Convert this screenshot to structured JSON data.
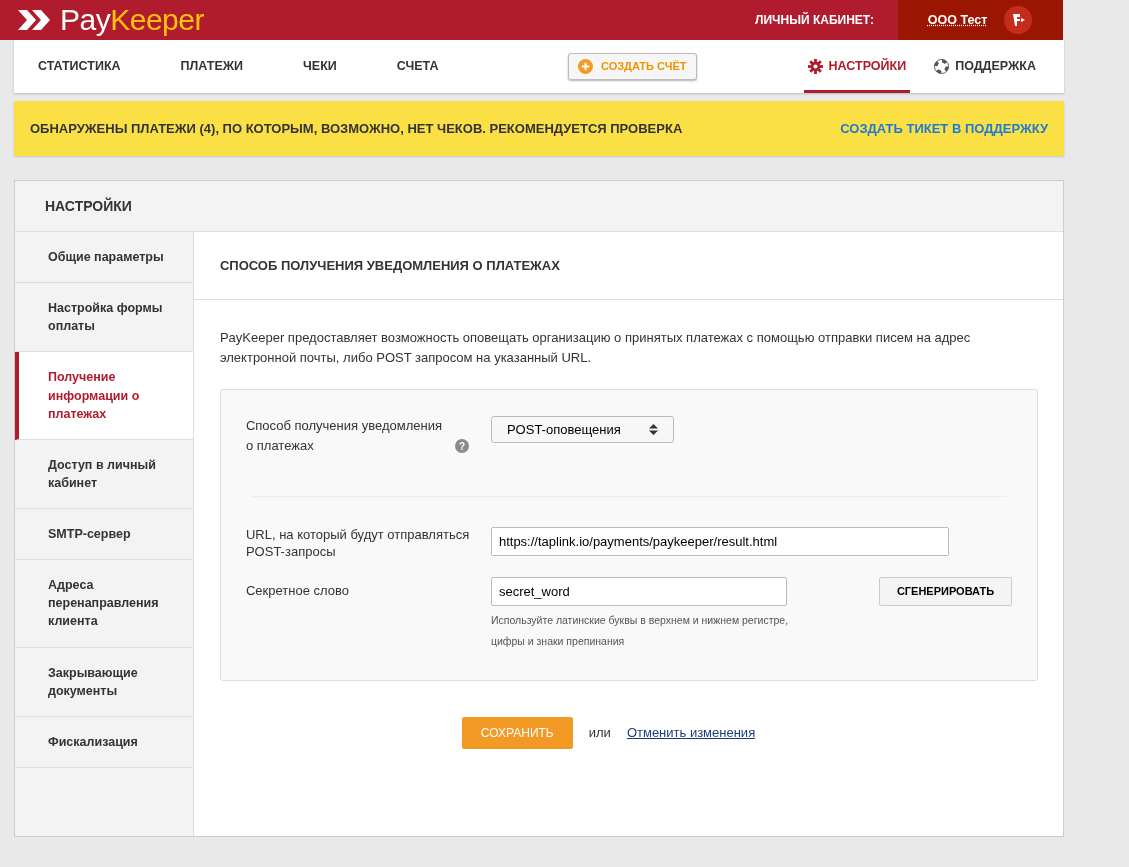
{
  "header": {
    "logo": {
      "first": "Pay",
      "second": "Keeper"
    },
    "cabinet_label": "ЛИЧНЫЙ КАБИНЕТ:",
    "account": "ООО Тест"
  },
  "nav": {
    "left": [
      {
        "label": "СТАТИСТИКА",
        "selected": false
      },
      {
        "label": "ПЛАТЕЖИ",
        "selected": false
      },
      {
        "label": "ЧЕКИ",
        "selected": false
      },
      {
        "label": "СЧЕТА",
        "selected": false
      }
    ],
    "create_button": "СОЗДАТЬ СЧЁТ",
    "right": [
      {
        "label": "НАСТРОЙКИ",
        "kind": "gear",
        "selected": true
      },
      {
        "label": "ПОДДЕРЖКА",
        "kind": "lifebuoy",
        "selected": false
      }
    ]
  },
  "alert": {
    "message": "ОБНАРУЖЕНЫ ПЛАТЕЖИ (4), ПО КОТОРЫМ, ВОЗМОЖНО, НЕТ ЧЕКОВ. РЕКОМЕНДУЕТСЯ ПРОВЕРКА",
    "link": "СОЗДАТЬ ТИКЕТ В ПОДДЕРЖКУ"
  },
  "settings": {
    "title": "НАСТРОЙКИ",
    "sidebar": [
      {
        "label": "Общие параметры",
        "selected": false
      },
      {
        "label": "Настройка формы оплаты",
        "selected": false
      },
      {
        "label": "Получение информации о платежах",
        "selected": true
      },
      {
        "label": "Доступ в личный кабинет",
        "selected": false
      },
      {
        "label": "SMTP-сервер",
        "selected": false
      },
      {
        "label": "Адреса перенаправления клиента",
        "selected": false
      },
      {
        "label": "Закрывающие документы",
        "selected": false
      },
      {
        "label": "Фискализация",
        "selected": false
      }
    ],
    "section_title": "СПОСОБ ПОЛУЧЕНИЯ УВЕДОМЛЕНИЯ О ПЛАТЕЖАХ",
    "description": "PayKeeper предоставляет возможность оповещать организацию о принятых платежах с помощью отправки писем на адрес электронной почты, либо POST запросом на указанный URL.",
    "method": {
      "label": "Способ получения уведомления о платежах",
      "help": "?",
      "value": "POST-оповещения"
    },
    "url": {
      "label": "URL, на который будут отправляться POST-запросы",
      "value": "https://taplink.io/payments/paykeeper/result.html"
    },
    "secret": {
      "label": "Секретное слово",
      "value": "secret_word",
      "button": "СГЕНЕРИРОВАТЬ",
      "hint": "Используйте латинские буквы в верхнем и нижнем регистре, цифры и знаки препинания"
    },
    "save": "СОХРАНИТЬ",
    "or": "или",
    "cancel": "Отменить изменения"
  }
}
